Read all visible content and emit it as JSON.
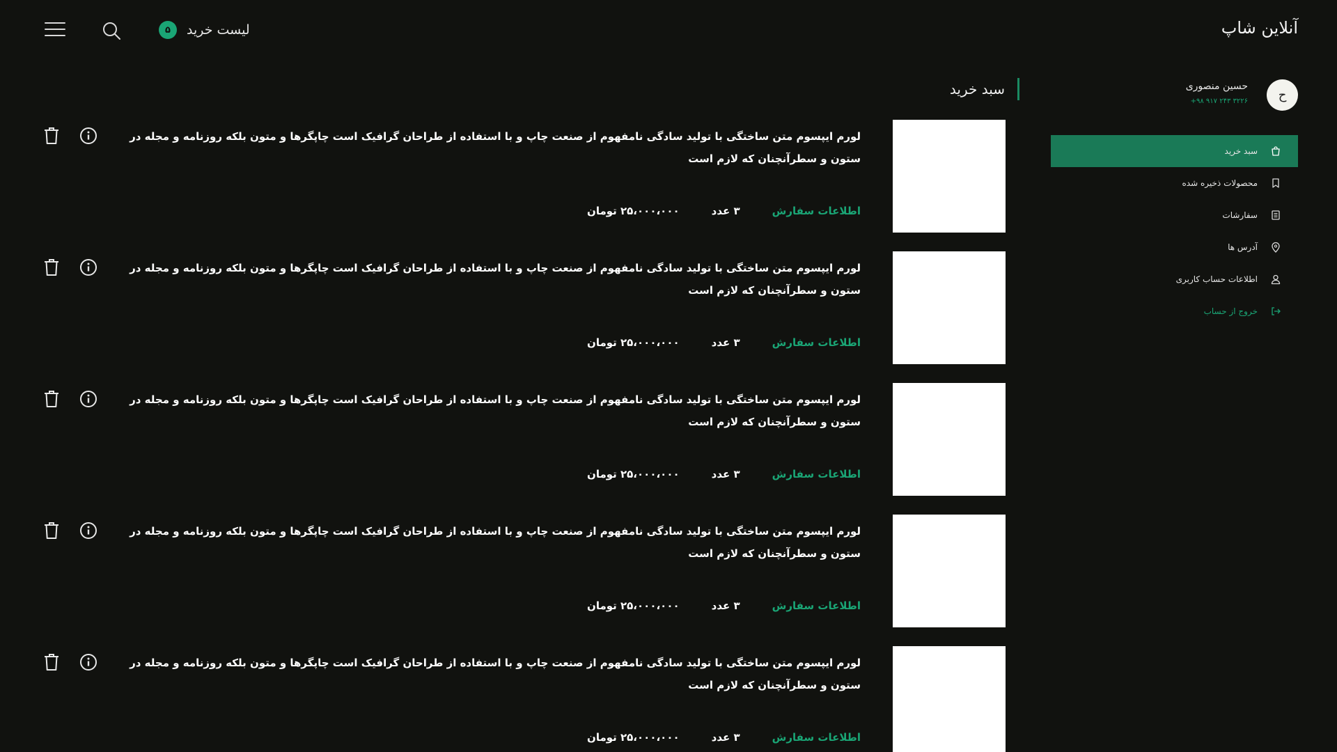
{
  "header": {
    "brand": "آنلاین شاپ",
    "cart_label": "لیست خرید",
    "cart_count": "۵"
  },
  "user": {
    "initial": "ح",
    "name": "حسین منصوری",
    "phone": "+۹۸ ۹۱۷ ۲۴۳ ۳۲۲۶"
  },
  "sidebar": {
    "items": [
      {
        "label": "سبد خرید",
        "icon": "bag-icon",
        "active": true
      },
      {
        "label": "محصولات ذخیره شده",
        "icon": "bookmark-icon"
      },
      {
        "label": "سفارشات",
        "icon": "orders-icon"
      },
      {
        "label": "آدرس ها",
        "icon": "location-icon"
      },
      {
        "label": "اطلاعات حساب کاربری",
        "icon": "user-icon"
      },
      {
        "label": "خروج از حساب",
        "icon": "logout-icon"
      }
    ]
  },
  "section_title": "سبد خرید",
  "cart_items": [
    {
      "description": "لورم ایپسوم متن ساختگی با تولید سادگی نامفهوم از صنعت چاپ و با استفاده از طراحان گرافیک است چاپگرها و متون بلکه روزنامه و مجله در ستون و سطرآنچنان که لازم است",
      "order_info": "اطلاعات سفارش",
      "quantity": "۳ عدد",
      "price": "۲۵،۰۰۰،۰۰۰ تومان"
    },
    {
      "description": "لورم ایپسوم متن ساختگی با تولید سادگی نامفهوم از صنعت چاپ و با استفاده از طراحان گرافیک است چاپگرها و متون بلکه روزنامه و مجله در ستون و سطرآنچنان که لازم است",
      "order_info": "اطلاعات سفارش",
      "quantity": "۳ عدد",
      "price": "۲۵،۰۰۰،۰۰۰ تومان"
    },
    {
      "description": "لورم ایپسوم متن ساختگی با تولید سادگی نامفهوم از صنعت چاپ و با استفاده از طراحان گرافیک است چاپگرها و متون بلکه روزنامه و مجله در ستون و سطرآنچنان که لازم است",
      "order_info": "اطلاعات سفارش",
      "quantity": "۳ عدد",
      "price": "۲۵،۰۰۰،۰۰۰ تومان"
    },
    {
      "description": "لورم ایپسوم متن ساختگی با تولید سادگی نامفهوم از صنعت چاپ و با استفاده از طراحان گرافیک است چاپگرها و متون بلکه روزنامه و مجله در ستون و سطرآنچنان که لازم است",
      "order_info": "اطلاعات سفارش",
      "quantity": "۳ عدد",
      "price": "۲۵،۰۰۰،۰۰۰ تومان"
    },
    {
      "description": "لورم ایپسوم متن ساختگی با تولید سادگی نامفهوم از صنعت چاپ و با استفاده از طراحان گرافیک است چاپگرها و متون بلکه روزنامه و مجله در ستون و سطرآنچنان که لازم است",
      "order_info": "اطلاعات سفارش",
      "quantity": "۳ عدد",
      "price": "۲۵،۰۰۰،۰۰۰ تومان"
    }
  ],
  "colors": {
    "background": "#11120f",
    "accent": "#1aa575",
    "active_menu": "#1a7a57"
  }
}
